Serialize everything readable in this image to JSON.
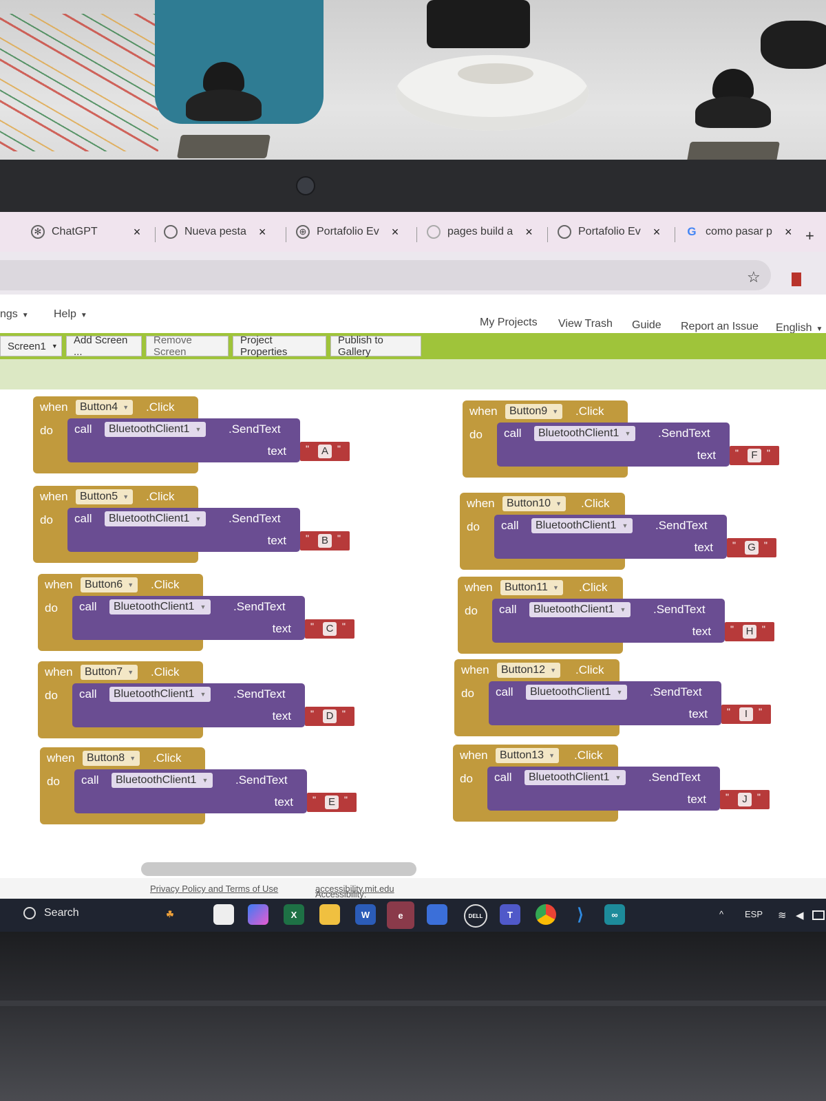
{
  "browser": {
    "tabs": [
      {
        "title": "ChatGPT",
        "icon": "chatgpt-icon"
      },
      {
        "title": "Nueva pesta",
        "icon": "chrome-icon"
      },
      {
        "title": "Portafolio Ev",
        "icon": "globe-icon"
      },
      {
        "title": "pages build a",
        "icon": "loading-icon"
      },
      {
        "title": "Portafolio Ev",
        "icon": "github-icon"
      },
      {
        "title": "como pasar p",
        "icon": "google-icon"
      }
    ],
    "close_glyph": "×",
    "new_tab_glyph": "+",
    "star_glyph": "☆"
  },
  "app": {
    "menu_left": [
      {
        "label": "ngs"
      },
      {
        "label": "Help"
      }
    ],
    "menu_right": [
      {
        "label": "My Projects"
      },
      {
        "label": "View Trash"
      },
      {
        "label": "Guide"
      },
      {
        "label": "Report an Issue"
      },
      {
        "label": "English"
      }
    ],
    "toolbar": [
      {
        "label": "Screen1"
      },
      {
        "label": "Add Screen ..."
      },
      {
        "label": "Remove Screen"
      },
      {
        "label": "Project Properties"
      },
      {
        "label": "Publish to Gallery"
      }
    ],
    "accent_color": "#9fc43a"
  },
  "blocks": {
    "when": "when",
    "do": "do",
    "call": "call",
    "click": ".Click",
    "method": ".SendText",
    "arg": "text",
    "component": "BluetoothClient1",
    "colors": {
      "event": "#c19a3d",
      "call": "#6a4d92",
      "text": "#b73a3a"
    },
    "items": [
      {
        "button": "Button4",
        "value": "A"
      },
      {
        "button": "Button5",
        "value": "B"
      },
      {
        "button": "Button6",
        "value": "C"
      },
      {
        "button": "Button7",
        "value": "D"
      },
      {
        "button": "Button8",
        "value": "E"
      },
      {
        "button": "Button9",
        "value": "F"
      },
      {
        "button": "Button10",
        "value": "G"
      },
      {
        "button": "Button11",
        "value": "H"
      },
      {
        "button": "Button12",
        "value": "I"
      },
      {
        "button": "Button13",
        "value": "J"
      }
    ]
  },
  "footer": {
    "privacy": "Privacy Policy and Terms of Use",
    "accessibility_label": "Accessibility:",
    "accessibility_link": "accessibility.mit.edu"
  },
  "taskbar": {
    "search": "Search",
    "apps": [
      "accessibility-app-icon",
      "task-view-icon",
      "copilot-icon",
      "excel-icon",
      "file-explorer-icon",
      "word-icon",
      "edge-icon",
      "store-icon",
      "dell-icon",
      "teams-icon",
      "chrome-icon",
      "vscode-icon",
      "arduino-icon"
    ],
    "lang": "ESP",
    "chevron": "^"
  }
}
